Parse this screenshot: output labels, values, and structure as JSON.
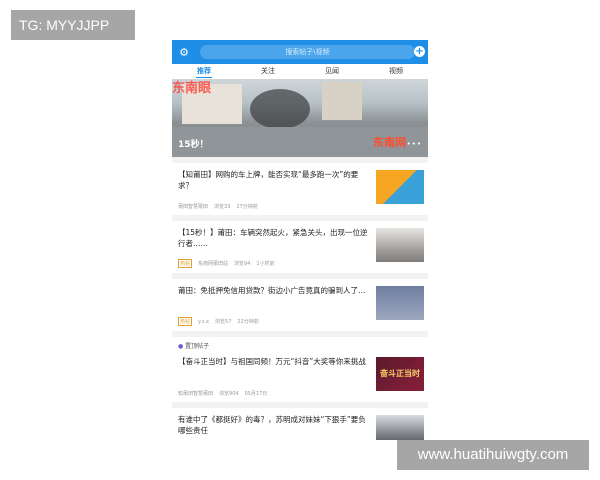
{
  "overlay": {
    "tg_label": "TG: MYYJJPP",
    "watermark": "www.huatihuiwgty.com"
  },
  "topbar": {
    "search_placeholder": "搜索帖子\\视频",
    "plus_symbol": "+"
  },
  "tabs": [
    {
      "label": "推荐",
      "active": true
    },
    {
      "label": "关注",
      "active": false
    },
    {
      "label": "见闻",
      "active": false
    },
    {
      "label": "视频",
      "active": false
    }
  ],
  "hero": {
    "caption": "15秒！",
    "brand": "东南网",
    "banner_text": "东南眼",
    "dots": "•••"
  },
  "feed": [
    {
      "title": "【知莆田】网购的车上牌，能否实现“最多跑一次”的要求？",
      "tag": "",
      "source": "莆田智慧莆田",
      "comments": "浏览33",
      "time": "27分钟前",
      "thumb_icon": "cars-thumbnail"
    },
    {
      "title": "【15秒！】莆田：车辆突然起火，紧急关头，出现一位逆行者……",
      "tag": "热帖",
      "source": "东南网莆田站",
      "comments": "浏览94",
      "time": "1小时前",
      "thumb_icon": "fire-scene-thumbnail"
    },
    {
      "title": "莆田：免抵押免信用贷款？街边小广告竟真的骗到人了…",
      "tag": "热帖",
      "source": "y.s.x",
      "comments": "浏览57",
      "time": "22分钟前",
      "thumb_icon": "street-ad-thumbnail"
    }
  ],
  "pinned": {
    "label": "置顶帖子",
    "items": [
      {
        "title": "【奋斗正当时】与祖国同频！万元“抖音”大奖等你来挑战",
        "tag": "",
        "source": "知莆田智慧莆田",
        "comments": "浏览904",
        "time": "05月17日",
        "thumb_text": "奋斗正当时",
        "thumb_icon": "campaign-poster-thumbnail"
      },
      {
        "title": "有谁中了《都挺好》的毒？，苏明成对妹妹“下狠手”要负哪些责任",
        "tag": "热帖",
        "source": "",
        "comments": "",
        "time": "",
        "thumb_icon": "tv-drama-thumbnail"
      }
    ]
  },
  "colors": {
    "brand_blue": "#1f8ee6",
    "hot_tag": "#e0a030"
  }
}
